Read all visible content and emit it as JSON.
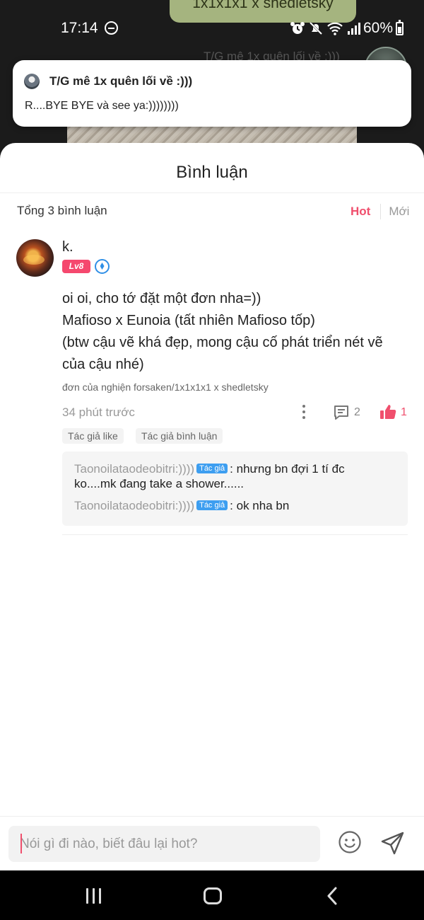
{
  "background": {
    "tag_text": "1x1x1x1 x shedletsky",
    "faded_title": "T/G mê 1x quên lối về :)))"
  },
  "status_bar": {
    "time": "17:14",
    "battery": "60%"
  },
  "notification": {
    "title": "T/G mê 1x quên lối về :)))",
    "body": "R....BYE BYE và see ya:))))))))"
  },
  "sheet": {
    "title": "Bình luận",
    "total": "Tổng 3 bình luận",
    "sort_hot": "Hot",
    "sort_new": "Mới"
  },
  "comment": {
    "username": "k.",
    "level": "Lv8",
    "text_lines": [
      "oi oi, cho tớ đặt một đơn nha=))",
      "Mafioso x Eunoia (tất nhiên Mafioso tốp)",
      "(btw cậu vẽ khá đẹp, mong cậu cố phát triển nét vẽ",
      "của cậu nhé)"
    ],
    "sub": "đơn của nghiện forsaken/1x1x1x1 x shedletsky",
    "time": "34 phút trước",
    "reply_count": "2",
    "like_count": "1",
    "tags": [
      "Tác giả like",
      "Tác giả bình luận"
    ],
    "replies": [
      {
        "user": "Taonoilataodeobitri:))))",
        "badge": "Tác giả",
        "text_a": ": nhưng bn đợi 1 tí đc",
        "text_b": "ko....mk đang take a shower......"
      },
      {
        "user": "Taonoilataodeobitri:))))",
        "badge": "Tác giả",
        "text_a": ": ok nha bn",
        "text_b": ""
      }
    ]
  },
  "composer": {
    "placeholder": "Nói gì đi nào, biết đâu lại hot?"
  },
  "colors": {
    "accent": "#f04f6d",
    "author_badge": "#3d9ef0",
    "notification_bg": "#ffffff",
    "navbar": "#000000"
  },
  "icons": [
    "dnd-icon",
    "alarm-icon",
    "mute-icon",
    "wifi-icon",
    "signal-icon",
    "battery-icon",
    "verified-icon",
    "more-icon",
    "reply-icon",
    "like-icon",
    "emoji-icon",
    "send-icon",
    "nav-recents-icon",
    "nav-home-icon",
    "nav-back-icon"
  ]
}
